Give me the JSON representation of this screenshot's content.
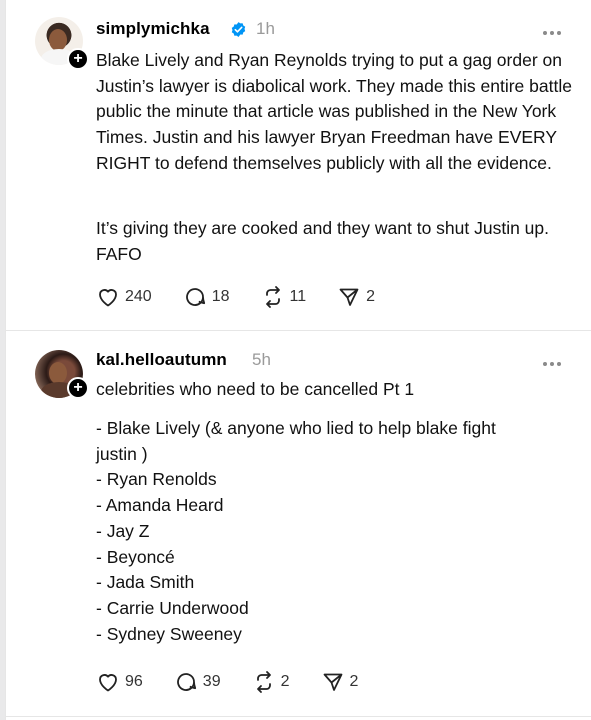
{
  "posts": [
    {
      "username": "simplymichka",
      "verified": true,
      "time": "1h",
      "paragraphs": [
        "Blake Lively and Ryan Reynolds trying to put a gag order on Justin’s lawyer is diabolical work. They made this entire battle public the minute that article was published in the New York Times. Justin and his lawyer Bryan Freedman have EVERY RIGHT to defend themselves publicly with all the evidence.",
        "It’s giving they are cooked and they want to shut Justin up. FAFO"
      ],
      "likes": "240",
      "replies": "18",
      "reposts": "11",
      "shares": "2"
    },
    {
      "username": "kal.helloautumn",
      "verified": false,
      "time": "5h",
      "paragraphs": [
        "celebrities who need to be cancelled Pt 1"
      ],
      "list": [
        "- Blake Lively (& anyone who lied to help blake fight",
        "justin )",
        "- Ryan Renolds",
        "- Amanda Heard",
        "- Jay Z",
        "- Beyoncé",
        "- Jada Smith",
        "- Carrie Underwood",
        "- Sydney Sweeney"
      ],
      "likes": "96",
      "replies": "39",
      "reposts": "2",
      "shares": "2"
    }
  ],
  "icons": {
    "badge": "plus-icon",
    "verified": "verified-check-icon",
    "more": "more-dots-icon",
    "like": "heart-icon",
    "reply": "comment-icon",
    "repost": "repost-icon",
    "share": "send-icon"
  },
  "colors": {
    "verified": "#0095f6",
    "muted": "#9a9a9a"
  }
}
